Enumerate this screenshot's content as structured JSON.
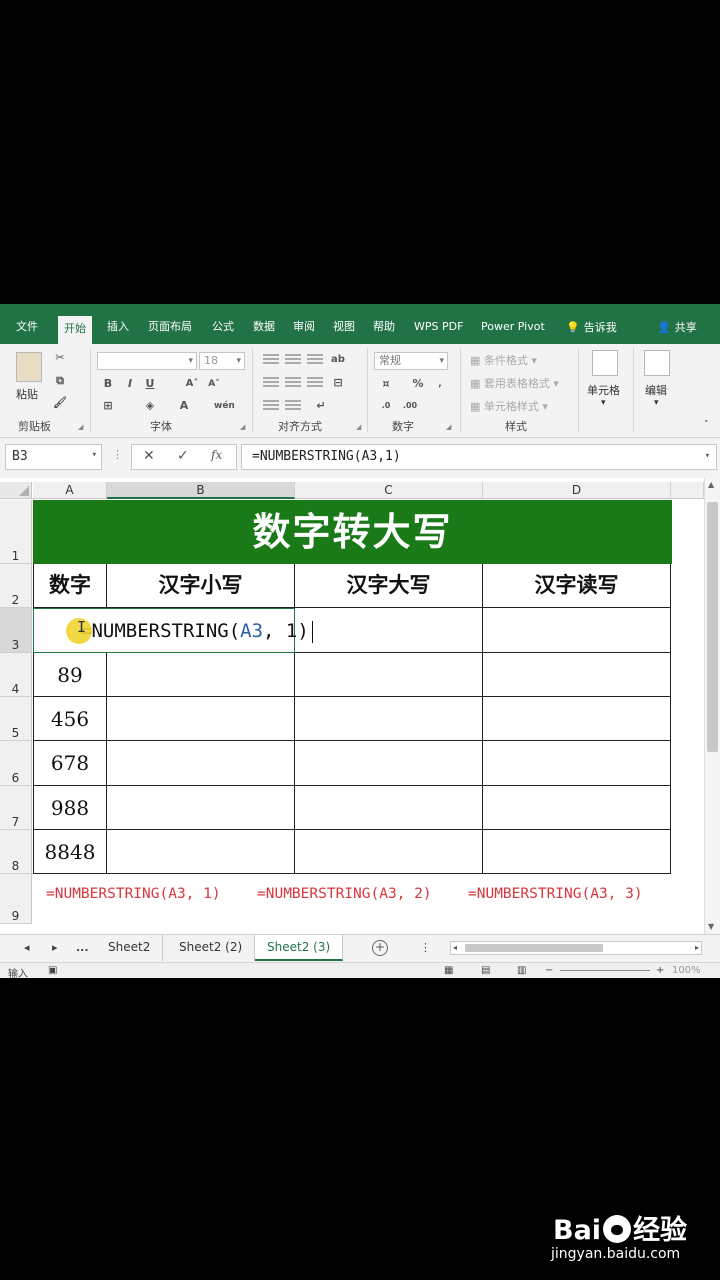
{
  "ribbon_tabs": [
    "文件",
    "开始",
    "插入",
    "页面布局",
    "公式",
    "数据",
    "审阅",
    "视图",
    "帮助",
    "WPS PDF",
    "Power Pivot"
  ],
  "active_tab": "开始",
  "tell_me": "告诉我",
  "share": "共享",
  "ribbon": {
    "paste": "粘贴",
    "clipboard": "剪贴板",
    "font_group": "字体",
    "font_size": "18",
    "bold": "B",
    "italic": "I",
    "underline": "U",
    "align_group": "对齐方式",
    "number_format": "常规",
    "number_group": "数字",
    "cond_format": "条件格式",
    "table_format": "套用表格格式",
    "cell_style": "单元格样式",
    "styles_group": "样式",
    "cells": "单元格",
    "edit": "编辑",
    "percent": "%"
  },
  "name_box": "B3",
  "formula_bar": "=NUMBERSTRING(A3,1)",
  "columns": [
    "A",
    "B",
    "C",
    "D"
  ],
  "rows": [
    "1",
    "2",
    "3",
    "4",
    "5",
    "6",
    "7",
    "8",
    "9"
  ],
  "sheet": {
    "title": "数字转大写",
    "headers": [
      "数字",
      "汉字小写",
      "汉字大写",
      "汉字读写"
    ],
    "edit_prefix": "=NUMBERSTRING(",
    "edit_ref": "A3",
    "edit_suffix": ", 1)",
    "numbers": [
      "89",
      "456",
      "678",
      "988",
      "8848"
    ],
    "formulas": [
      "=NUMBERSTRING(A3, 1)",
      "=NUMBERSTRING(A3, 2)",
      "=NUMBERSTRING(A3, 3)"
    ]
  },
  "sheet_tabs": [
    "Sheet2",
    "Sheet2 (2)",
    "Sheet2 (3)"
  ],
  "active_sheet": "Sheet2 (3)",
  "status": {
    "mode": "输入",
    "zoom": "100%"
  },
  "watermark": {
    "brand_left": "Bai",
    "brand_right": "经验",
    "url": "jingyan.baidu.com"
  },
  "colors": {
    "excel_green": "#217346",
    "banner_green": "#1a7a17",
    "formula_red": "#d9363e"
  }
}
